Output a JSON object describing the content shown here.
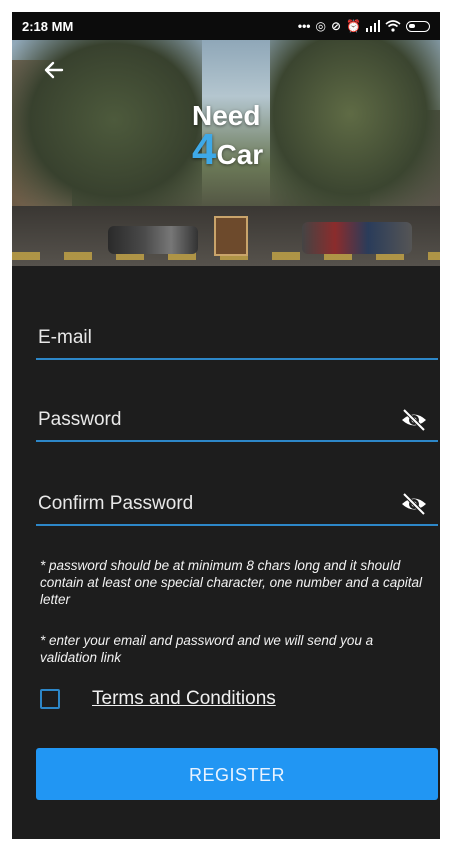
{
  "status_bar": {
    "time": "2:18 MM",
    "icons": [
      "dots-icon",
      "hotspot-icon",
      "mute-icon",
      "alarm-icon",
      "signal-icon",
      "wifi-icon",
      "battery-icon"
    ]
  },
  "header": {
    "back_icon": "back-arrow-icon",
    "logo_line1": "Need",
    "logo_number": "4",
    "logo_word": "Car"
  },
  "form": {
    "email_placeholder": "E-mail",
    "password_placeholder": "Password",
    "confirm_placeholder": "Confirm Password",
    "visibility_icon": "eye-off-icon",
    "note_password": "* password should be at minimum 8 chars long and it should contain at least one special character, one number and a capital letter",
    "note_email": "* enter your email and password and we will send you a validation link",
    "terms_label": "Terms and Conditions",
    "terms_checked": false,
    "register_label": "REGISTER"
  },
  "colors": {
    "background": "#1d1d1d",
    "accent": "#2196f3",
    "underline": "#2d87c8",
    "logo_accent": "#3ea9e8"
  }
}
